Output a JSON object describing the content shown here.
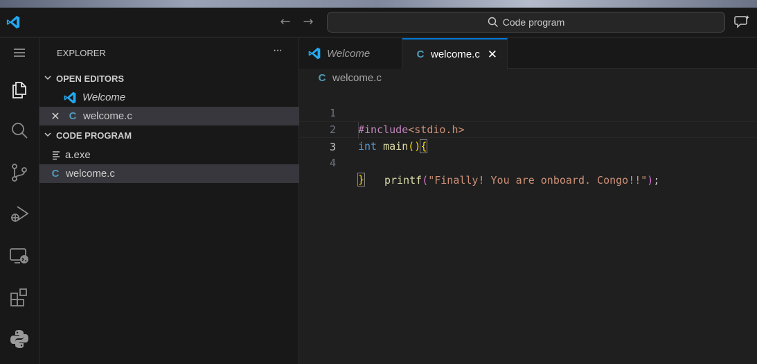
{
  "titlebar": {
    "search_text": "Code program",
    "back_icon": "arrow-left-icon",
    "forward_icon": "arrow-right-icon"
  },
  "activity_bar": {
    "items": [
      "menu-icon",
      "explorer-icon",
      "search-icon",
      "source-control-icon",
      "run-debug-icon",
      "remote-explorer-icon",
      "extensions-icon",
      "python-icon"
    ]
  },
  "sidebar": {
    "title": "EXPLORER",
    "more": "···",
    "open_editors_header": "OPEN EDITORS",
    "open_editors": [
      {
        "label": "Welcome",
        "icon": "vscode-icon"
      },
      {
        "label": "welcome.c",
        "icon": "c-file-icon"
      }
    ],
    "folder_header": "CODE PROGRAM",
    "files": [
      {
        "label": "a.exe",
        "icon": "lines-file-icon"
      },
      {
        "label": "welcome.c",
        "icon": "c-file-icon"
      }
    ]
  },
  "editor": {
    "tabs": [
      {
        "label": "Welcome",
        "active": false
      },
      {
        "label": "welcome.c",
        "active": true
      }
    ],
    "breadcrumb": "welcome.c",
    "c_glyph": "C",
    "lines": [
      {
        "num": "1",
        "parts": [
          "#include",
          "<stdio.h>"
        ]
      },
      {
        "num": "2",
        "parts": [
          "int",
          " ",
          "main",
          "(",
          ")",
          "{"
        ]
      },
      {
        "num": "3",
        "parts": [
          "printf",
          "(",
          "\"Finally! You are onboard. Congo!!\"",
          ")",
          ";"
        ]
      },
      {
        "num": "4",
        "parts": [
          "}"
        ]
      }
    ]
  },
  "colors": {
    "accent": "#0078d4",
    "c_icon": "#519aba",
    "vscode_blue": "#23a9f2"
  }
}
